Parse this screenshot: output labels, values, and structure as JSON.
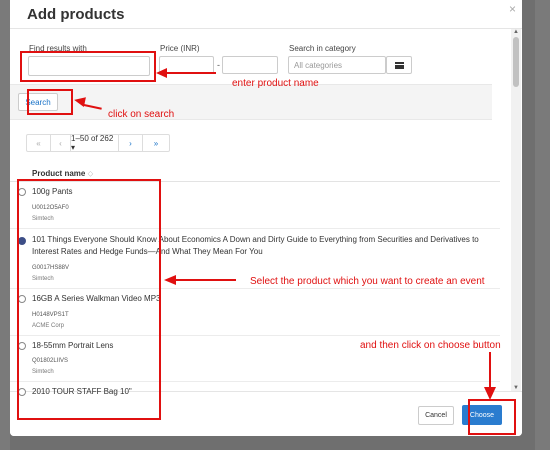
{
  "modal": {
    "title": "Add products",
    "close_glyph": "×"
  },
  "filters": {
    "find_label": "Find results with",
    "find_value": "",
    "price_label": "Price (INR)",
    "price_sep": "-",
    "category_label": "Search in category",
    "category_placeholder": "All categories",
    "search_button": "Search"
  },
  "pagination": {
    "first": "«",
    "prev": "‹",
    "range": "1–50 of 262 ▾",
    "next": "›",
    "last": "»"
  },
  "table": {
    "column_header": "Product name",
    "sort_mark": "⬦",
    "products": [
      {
        "name": "100g Pants",
        "code": "U0012O5AF0",
        "vendor": "Simtech",
        "selected": false
      },
      {
        "name": "101 Things Everyone Should Know About Economics A Down and Dirty Guide to Everything from Securities and Derivatives to Interest Rates and Hedge Funds—And What They Mean For You",
        "code": "G0017HS88V",
        "vendor": "Simtech",
        "selected": true
      },
      {
        "name": "16GB A Series Walkman Video MP3",
        "code": "H0148VPS1T",
        "vendor": "ACME Corp",
        "selected": false
      },
      {
        "name": "18-55mm Portrait Lens",
        "code": "Q01802LIIVS",
        "vendor": "Simtech",
        "selected": false
      },
      {
        "name": "2010 TOUR STAFF Bag 10\"",
        "code": "",
        "vendor": "",
        "selected": false
      }
    ]
  },
  "footer": {
    "cancel": "Cancel",
    "choose": "Choose"
  },
  "annotations": {
    "enter_product": "enter product name",
    "click_search": "click on search",
    "select_product": "Select the product which you want to create an event",
    "choose_note": "and then click on choose button"
  },
  "colors": {
    "annotation": "#e01010",
    "primary": "#2a7ccf",
    "radio_checked": "#3d4e87"
  }
}
